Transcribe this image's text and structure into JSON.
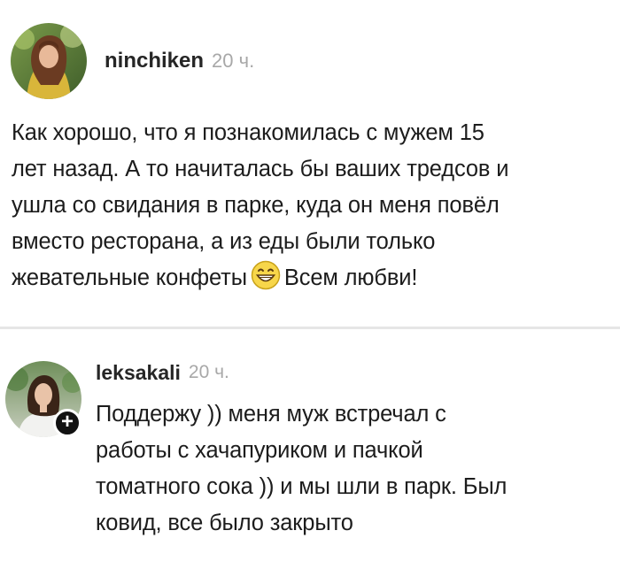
{
  "post": {
    "username": "ninchiken",
    "time": "20 ч.",
    "text_before_emoji": "Как хорошо, что я познакомилась с мужем 15\nлет назад. А то начиталась бы ваших тредсов и\nушла со свидания в парке, куда он меня повёл\nвместо ресторана, а из еды были только\nжевательные конфеты",
    "emoji": "grinning-face-with-smiling-eyes-emoji",
    "text_after_emoji": "Всем любви!"
  },
  "comment": {
    "username": "leksakali",
    "time": "20 ч.",
    "badge": "+",
    "text": "Поддержу )) меня муж встречал с\nработы с хачапуриком и пачкой\nтоматного сока )) и мы шли в парк. Был\nковид, все было закрыто"
  },
  "colors": {
    "username": "#262626",
    "timestamp": "#a8a8a8",
    "body_text": "#1c1c1c",
    "divider": "#e6e6e6",
    "badge": "#111111"
  }
}
